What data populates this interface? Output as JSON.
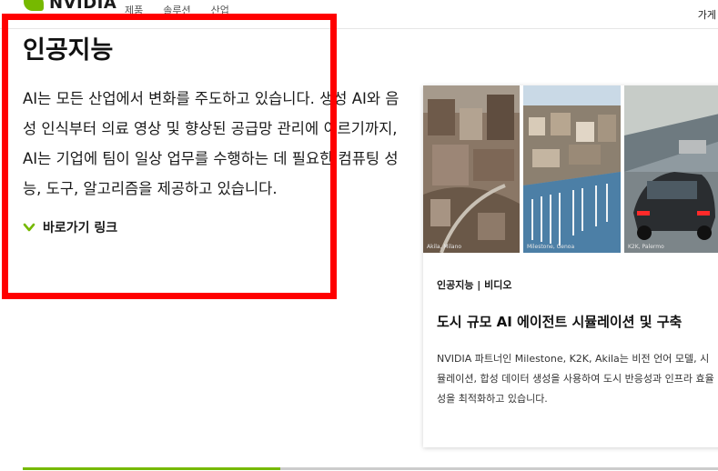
{
  "nav": {
    "logo_text": "NVIDIA",
    "items": [
      "제품",
      "솔루션",
      "산업"
    ],
    "right_label": "가게"
  },
  "section": {
    "heading": "인공지능",
    "intro": "AI는 모든 산업에서 변화를 주도하고 있습니다. 생성 AI와 음성 인식부터 의료 영상 및 향상된 공급망 관리에 이르기까지, AI는 기업에 팀이 일상 업무를 수행하는 데 필요한 컴퓨팅 성능, 도구, 알고리즘을 제공하고 있습니다.",
    "quicklinks_label": "바로가기 링크",
    "quicklinks_icon": "chevron-down-icon"
  },
  "card": {
    "thumbs": [
      {
        "caption": "Akila, Milano"
      },
      {
        "caption": "Milestone, Genoa"
      },
      {
        "caption": "K2K, Palermo"
      }
    ],
    "tag": "인공지능 | 비디오",
    "title": "도시 규모 AI 에이전트 시뮬레이션 및 구축",
    "description": "NVIDIA 파트너인 Milestone, K2K, Akila는 비전 언어 모델, 시뮬레이션, 합성 데이터 생성을 사용하여 도시 반응성과 인프라 효율성을 최적화하고 있습니다."
  },
  "carousel": {
    "progress": 0.37
  },
  "colors": {
    "accent": "#76b900",
    "annotation": "#ff0000"
  }
}
